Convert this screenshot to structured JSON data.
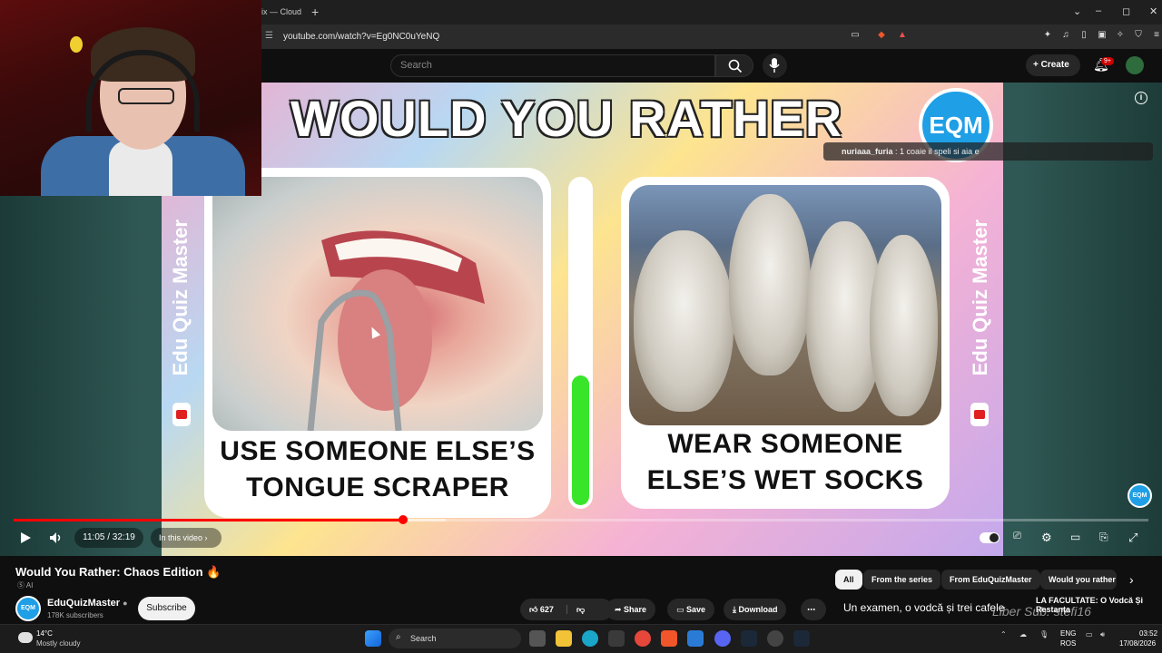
{
  "browser": {
    "tab_fragment": "ix — Cloud",
    "new_tab": "+",
    "url": "youtube.com/watch?v=Eg0NC0uYeNQ",
    "min": "⌄",
    "minimize": "–",
    "maximize": "◻",
    "close": "✕"
  },
  "masthead": {
    "search_placeholder": "Search",
    "create_label": "Create",
    "notification_count": "9+"
  },
  "video": {
    "thumbnail_title": "WOULD YOU RATHER",
    "logo_text": "EQM",
    "side_brand": "Edu Quiz Master",
    "option_left": "USE SOMEONE ELSE’S TONGUE SCRAPER",
    "option_right": "WEAR SOMEONE ELSE’S WET SOCKS",
    "meter_level": 0.4,
    "chat_user": "nuriaaa_furia",
    "chat_message": "1 coaie il speli si aia e",
    "watermark": "EQM"
  },
  "player": {
    "time": "11:05 / 32:19",
    "chapter": "In this video",
    "played_fraction": 0.343,
    "buffered_fraction": 0.381
  },
  "details": {
    "title": "Would You Rather: Chaos Edition 🔥",
    "ai_tag": "Ⓢ AI",
    "channel_name": "EduQuizMaster",
    "channel_avatar": "EQM",
    "subscribers": "178K subscribers",
    "subscribe_label": "Subscribe",
    "like_count": "627",
    "share_label": "Share",
    "save_label": "Save",
    "download_label": "Download",
    "more": "⋯"
  },
  "chips": [
    "All",
    "From the series",
    "From EduQuizMaster",
    "Would you rather"
  ],
  "recommended": {
    "title": "Un examen, o vodcă și trei cafele",
    "thumb_text": "LA FACULTATE: O Vodcă Și Restanța",
    "thumb_overlay": "Liber Sub: stefi16"
  },
  "taskbar": {
    "temperature": "14°C",
    "condition": "Mostly cloudy",
    "search_label": "Search",
    "lang_top": "ENG",
    "lang_bottom": "ROS",
    "time": "03:52",
    "date": "17/08/2026"
  },
  "colors": {
    "progress": "#ff0000",
    "meter": "#39e52a",
    "brand_blue": "#1e9fe6"
  }
}
